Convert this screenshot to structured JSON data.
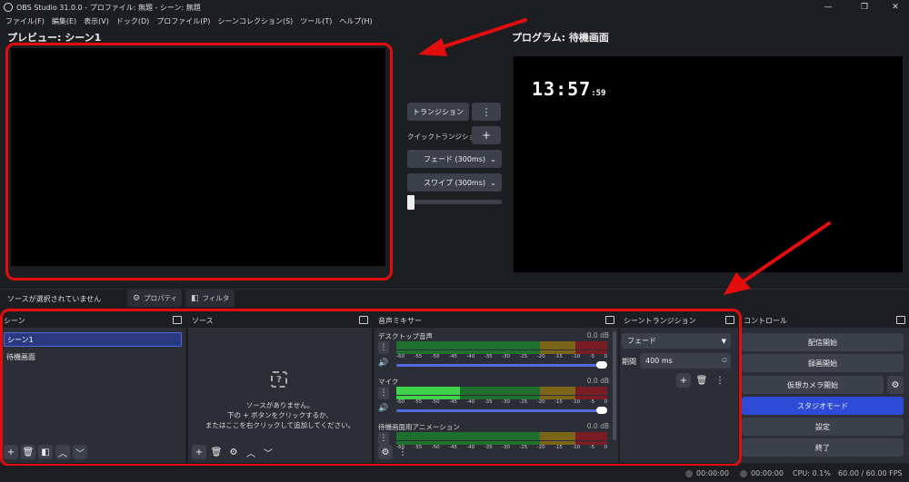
{
  "window": {
    "title": "OBS Studio 31.0.0 - プロファイル: 無題 - シーン: 無題",
    "controls": {
      "minimize": "—",
      "maximize": "❐",
      "close": "✕"
    }
  },
  "menu": [
    "ファイル(F)",
    "編集(E)",
    "表示(V)",
    "ドック(D)",
    "プロファイル(P)",
    "シーンコレクション(S)",
    "ツール(T)",
    "ヘルプ(H)"
  ],
  "preview": {
    "label": "プレビュー: シーン1"
  },
  "program": {
    "label": "プログラム: 待機画面",
    "clock_main": "13:57",
    "clock_sec": ":59"
  },
  "transition_panel": {
    "transition_button": "トランジション",
    "menu_glyph": "⋮",
    "quick_label": "クイックトランジション",
    "add_glyph": "+",
    "fade_option": "フェード (300ms)",
    "swipe_option": "スワイプ (300ms)",
    "chevron": "⌄"
  },
  "source_bar": {
    "status": "ソースが選択されていません",
    "properties": "プロパティ",
    "filters": "フィルタ"
  },
  "scenes": {
    "title": "シーン",
    "items": [
      "シーン1",
      "待機画面"
    ]
  },
  "sources": {
    "title": "ソース",
    "empty_icon": "?",
    "empty_line1": "ソースがありません。",
    "empty_line2": "下の + ボタンをクリックするか、",
    "empty_line3": "またはここを右クリックして追加してください。"
  },
  "mixer": {
    "title": "音声ミキサー",
    "scale": [
      "-60",
      "-55",
      "-50",
      "-45",
      "-40",
      "-35",
      "-30",
      "-25",
      "-20",
      "-15",
      "-10",
      "-5",
      "0"
    ],
    "channels": [
      {
        "name": "デスクトップ音声",
        "db": "0.0 dB",
        "level": 0
      },
      {
        "name": "マイク",
        "db": "0.0 dB",
        "level": 0.3
      },
      {
        "name": "待機画面用アニメーション",
        "db": "0.0 dB",
        "level": 0
      }
    ]
  },
  "scene_transitions": {
    "title": "シーントランジション",
    "selected": "フェード",
    "duration_label": "期間",
    "duration_value": "400 ms"
  },
  "controls": {
    "title": "コントロール",
    "start_stream": "配信開始",
    "start_record": "録画開始",
    "start_virtualcam": "仮想カメラ開始",
    "studio_mode": "スタジオモード",
    "settings": "設定",
    "exit": "終了"
  },
  "status": {
    "stream_time": "00:00:00",
    "record_time": "00:00:00",
    "cpu": "CPU: 0.1%",
    "fps": "60.00 / 60.00 FPS"
  },
  "colors": {
    "accent": "#2d4bd6",
    "annotation_red": "#e40d0d",
    "background": "#1c1e22",
    "panel": "#2b2e36"
  }
}
